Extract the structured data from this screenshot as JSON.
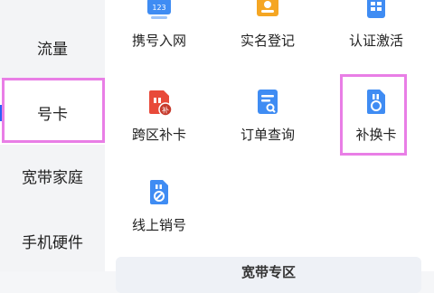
{
  "sidebar": {
    "items": [
      {
        "label": "流量"
      },
      {
        "label": "号卡"
      },
      {
        "label": "宽带家庭"
      },
      {
        "label": "手机硬件"
      }
    ]
  },
  "grid": {
    "tiles": [
      {
        "label": "携号入网",
        "icon": "number-transfer-icon"
      },
      {
        "label": "实名登记",
        "icon": "id-card-icon"
      },
      {
        "label": "认证激活",
        "icon": "activation-icon"
      },
      {
        "label": "跨区补卡",
        "icon": "sim-card-reissue-icon"
      },
      {
        "label": "订单查询",
        "icon": "order-search-icon"
      },
      {
        "label": "补换卡",
        "icon": "sim-card-replace-icon"
      },
      {
        "label": "线上销号",
        "icon": "sim-cancel-icon"
      }
    ]
  },
  "bottom": {
    "title": "宽带专区"
  },
  "colors": {
    "accent": "#2a63f6",
    "highlight": "#e97ee6",
    "icon_blue": "#3f8cf3",
    "icon_orange": "#f5a623",
    "icon_red": "#e84a3a"
  }
}
